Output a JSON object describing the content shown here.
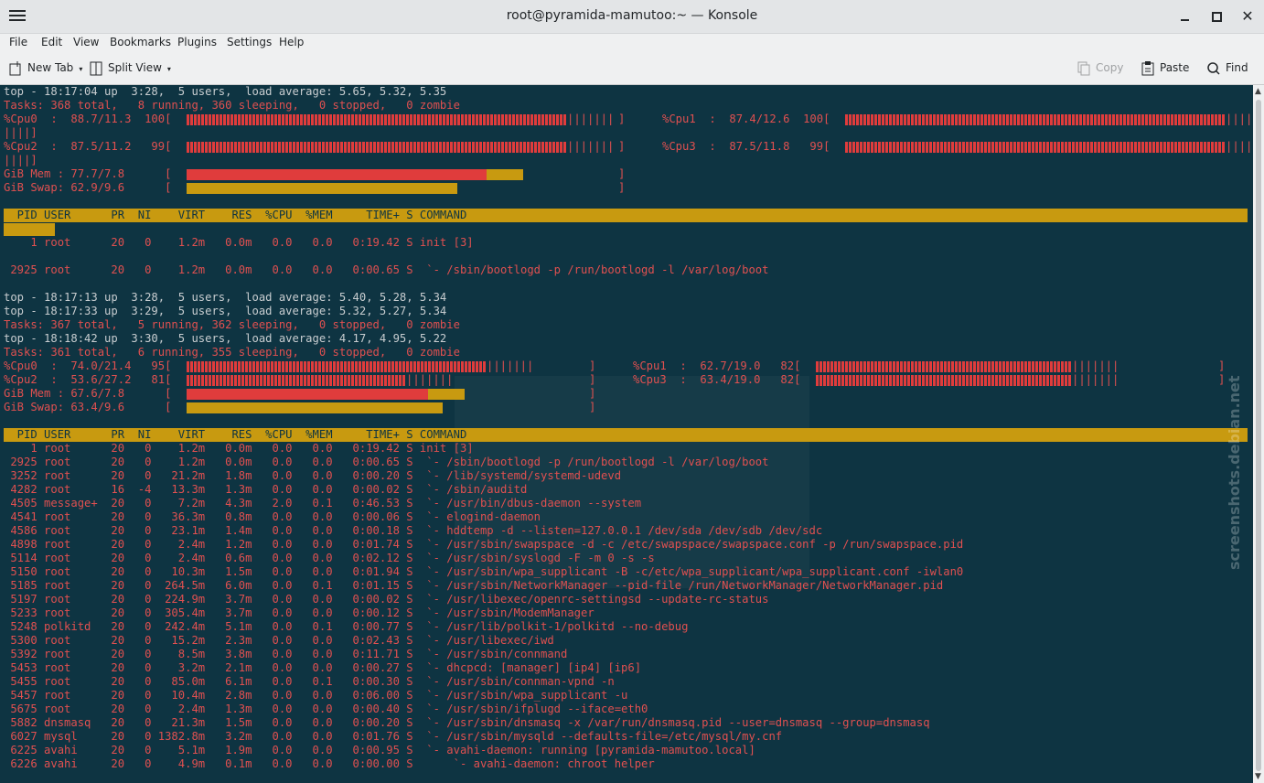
{
  "window": {
    "title": "root@pyramida-mamutoo:~ — Konsole",
    "close_glyph": "✕"
  },
  "menu": [
    "File",
    "Edit",
    "View",
    "Bookmarks",
    "Plugins",
    "Settings",
    "Help"
  ],
  "toolbar": {
    "new_tab": "New Tab",
    "split_view": "Split View",
    "copy": "Copy",
    "paste": "Paste",
    "find": "Find"
  },
  "colors": {
    "terminal_bg": "#0e3442",
    "text_red": "#e05050",
    "header_bg": "#c89a10"
  },
  "watermark": "screenshots.debian.net",
  "lines": {
    "l1": "top - 18:17:04 up  3:28,  5 users,  load average: 5.65, 5.32, 5.35",
    "l2": "Tasks: 368 total,   8 running, 360 sleeping,   0 stopped,   0 zombie",
    "l3a": "%Cpu0  :  88.7/11.3  100[",
    "l3b": "%Cpu1  :  87.4/12.6  100[",
    "l4": "||||]",
    "l5a": "%Cpu2  :  87.5/11.2   99[",
    "l5b": "%Cpu3  :  87.5/11.8   99[",
    "l6": "||||]",
    "l7": "GiB Mem : 77.7/7.8      [",
    "l8": "GiB Swap: 62.9/9.6      [",
    "hdr": "  PID USER      PR  NI    VIRT    RES  %CPU  %MEM     TIME+ S COMMAND",
    "p1": "    1 root      20   0    1.2m   0.0m   0.0   0.0   0:19.42 S init [3]",
    "p2": " 2925 root      20   0    1.2m   0.0m   0.0   0.0   0:00.65 S  `- /sbin/bootlogd -p /run/bootlogd -l /var/log/boot",
    "m1": "top - 18:17:13 up  3:28,  5 users,  load average: 5.40, 5.28, 5.34",
    "m2": "top - 18:17:33 up  3:29,  5 users,  load average: 5.32, 5.27, 5.34",
    "m3": "Tasks: 367 total,   5 running, 362 sleeping,   0 stopped,   0 zombie",
    "m4": "top - 18:18:42 up  3:30,  5 users,  load average: 4.17, 4.95, 5.22",
    "m5": "Tasks: 361 total,   6 running, 355 sleeping,   0 stopped,   0 zombie",
    "c0": "%Cpu0  :  74.0/21.4   95[",
    "c1": "%Cpu1  :  62.7/19.0   82[",
    "c2": "%Cpu2  :  53.6/27.2   81[",
    "c3": "%Cpu3  :  63.4/19.0   82[",
    "mem2": "GiB Mem : 67.6/7.8      [",
    "swap2": "GiB Swap: 63.4/9.6      [",
    "close_br": "]",
    "pipes": "|||||||",
    "pipes2": "|||||"
  },
  "processes": [
    "    1 root      20   0    1.2m   0.0m   0.0   0.0   0:19.42 S init [3]",
    " 2925 root      20   0    1.2m   0.0m   0.0   0.0   0:00.65 S  `- /sbin/bootlogd -p /run/bootlogd -l /var/log/boot",
    " 3252 root      20   0   21.2m   1.8m   0.0   0.0   0:00.20 S  `- /lib/systemd/systemd-udevd",
    " 4282 root      16  -4   13.3m   1.3m   0.0   0.0   0:00.02 S  `- /sbin/auditd",
    " 4505 message+  20   0    7.2m   4.3m   2.0   0.1   0:46.53 S  `- /usr/bin/dbus-daemon --system",
    " 4541 root      20   0   36.3m   0.8m   0.0   0.0   0:00.06 S  `- elogind-daemon",
    " 4586 root      20   0   23.1m   1.4m   0.0   0.0   0:00.18 S  `- hddtemp -d --listen=127.0.0.1 /dev/sda /dev/sdb /dev/sdc",
    " 4898 root      20   0    2.4m   1.2m   0.0   0.0   0:01.74 S  `- /usr/sbin/swapspace -d -c /etc/swapspace/swapspace.conf -p /run/swapspace.pid",
    " 5114 root      20   0    2.4m   0.6m   0.0   0.0   0:02.12 S  `- /usr/sbin/syslogd -F -m 0 -s -s",
    " 5150 root      20   0   10.3m   1.5m   0.0   0.0   0:01.94 S  `- /usr/sbin/wpa_supplicant -B -c/etc/wpa_supplicant/wpa_supplicant.conf -iwlan0",
    " 5185 root      20   0  264.5m   6.0m   0.0   0.1   0:01.15 S  `- /usr/sbin/NetworkManager --pid-file /run/NetworkManager/NetworkManager.pid",
    " 5197 root      20   0  224.9m   3.7m   0.0   0.0   0:00.02 S  `- /usr/libexec/openrc-settingsd --update-rc-status",
    " 5233 root      20   0  305.4m   3.7m   0.0   0.0   0:00.12 S  `- /usr/sbin/ModemManager",
    " 5248 polkitd   20   0  242.4m   5.1m   0.0   0.1   0:00.77 S  `- /usr/lib/polkit-1/polkitd --no-debug",
    " 5300 root      20   0   15.2m   2.3m   0.0   0.0   0:02.43 S  `- /usr/libexec/iwd",
    " 5392 root      20   0    8.5m   3.8m   0.0   0.0   0:11.71 S  `- /usr/sbin/connmand",
    " 5453 root      20   0    3.2m   2.1m   0.0   0.0   0:00.27 S  `- dhcpcd: [manager] [ip4] [ip6]",
    " 5455 root      20   0   85.0m   6.1m   0.0   0.1   0:00.30 S  `- /usr/sbin/connman-vpnd -n",
    " 5457 root      20   0   10.4m   2.8m   0.0   0.0   0:06.00 S  `- /usr/sbin/wpa_supplicant -u",
    " 5675 root      20   0    2.4m   1.3m   0.0   0.0   0:00.40 S  `- /usr/sbin/ifplugd --iface=eth0",
    " 5882 dnsmasq   20   0   21.3m   1.5m   0.0   0.0   0:00.20 S  `- /usr/sbin/dnsmasq -x /var/run/dnsmasq.pid --user=dnsmasq --group=dnsmasq",
    " 6027 mysql     20   0 1382.8m   3.2m   0.0   0.0   0:01.76 S  `- /usr/sbin/mysqld --defaults-file=/etc/mysql/my.cnf",
    " 6225 avahi     20   0    5.1m   1.9m   0.0   0.0   0:00.95 S  `- avahi-daemon: running [pyramida-mamutoo.local]",
    " 6226 avahi     20   0    4.9m   0.1m   0.0   0.0   0:00.00 S      `- avahi-daemon: chroot helper"
  ]
}
